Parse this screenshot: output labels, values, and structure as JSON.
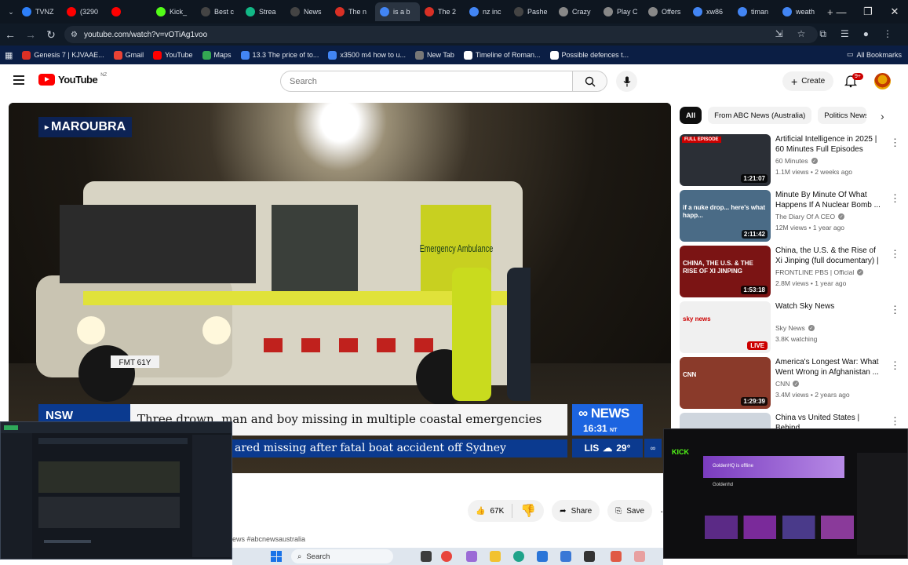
{
  "browser": {
    "tabs": [
      {
        "label": "TVNZ",
        "color": "#2d7ff9"
      },
      {
        "label": "(3290",
        "color": "#ff0000"
      },
      {
        "label": "",
        "color": "#ff0000"
      },
      {
        "label": "Kick_",
        "color": "#53fc18"
      },
      {
        "label": "Best c",
        "color": "#444444"
      },
      {
        "label": "Strea",
        "color": "#12b886"
      },
      {
        "label": "News",
        "color": "#444444"
      },
      {
        "label": "The n",
        "color": "#d93025"
      },
      {
        "label": "is a b",
        "color": "#4285f4"
      },
      {
        "label": "The 2",
        "color": "#d93025"
      },
      {
        "label": "nz inc",
        "color": "#4285f4"
      },
      {
        "label": "Pashe",
        "color": "#444444"
      },
      {
        "label": "Crazy",
        "color": "#888888"
      },
      {
        "label": "Play C",
        "color": "#888888"
      },
      {
        "label": "Offers",
        "color": "#888888"
      },
      {
        "label": "xw86",
        "color": "#4285f4"
      },
      {
        "label": "timan",
        "color": "#4285f4"
      },
      {
        "label": "weath",
        "color": "#4285f4"
      }
    ],
    "new_tab": "+",
    "url": "youtube.com/watch?v=vOTiAg1voo",
    "bookmarks": [
      {
        "label": "Genesis 7 | KJVAAE...",
        "color": "#d93025"
      },
      {
        "label": "Gmail",
        "color": "#ea4335"
      },
      {
        "label": "YouTube",
        "color": "#ff0000"
      },
      {
        "label": "Maps",
        "color": "#34a853"
      },
      {
        "label": "13.3 The price of to...",
        "color": "#4285f4"
      },
      {
        "label": "x3500 m4 how to u...",
        "color": "#4285f4"
      },
      {
        "label": "New Tab",
        "color": "#777777"
      },
      {
        "label": "Timeline of Roman...",
        "color": "#ffffff"
      },
      {
        "label": "Possible defences t...",
        "color": "#ffffff"
      }
    ],
    "all_bookmarks": "All Bookmarks"
  },
  "youtube": {
    "logo": "YouTube",
    "region": "NZ",
    "search_placeholder": "Search",
    "create": "Create",
    "notifications": "9+"
  },
  "video": {
    "location_tag": "MAROUBRA",
    "region_tag": "NSW",
    "headline": "Three drown, man and boy missing in multiple coastal emergencies",
    "ticker": "ared missing after fatal boat accident off Sydney",
    "channel_logo": "NEWS",
    "time": "16:31",
    "time_zone": "NT",
    "weather_city": "LIS",
    "temperature": "29°",
    "vehicle_text": "Emergency Ambulance",
    "plate": "FMT 61Y"
  },
  "actions": {
    "likes": "67K",
    "share": "Share",
    "save": "Save",
    "more": "···"
  },
  "description_snippet": "ews #abcnewsaustralia",
  "chips": [
    "All",
    "From ABC News (Australia)",
    "Politics News"
  ],
  "recommendations": [
    {
      "title": "Artificial Intelligence in 2025 | 60 Minutes Full Episodes",
      "channel": "60 Minutes",
      "meta": "1.1M views • 2 weeks ago",
      "duration": "1:21:07",
      "badge": "FULL EPISODE",
      "thumb": "#2b2f36"
    },
    {
      "title": "Minute By Minute Of What Happens If A Nuclear Bomb ...",
      "channel": "The Diary Of A CEO",
      "meta": "12M views • 1 year ago",
      "duration": "2:11:42",
      "overlay": "if a nuke drop... here's what happ...",
      "thumb": "#4a6b86"
    },
    {
      "title": "China, the U.S. & the Rise of Xi Jinping (full documentary) | ...",
      "channel": "FRONTLINE PBS | Official",
      "meta": "2.8M views • 1 year ago",
      "duration": "1:53:18",
      "overlay": "CHINA, THE U.S. & THE RISE OF XI JINPING",
      "thumb": "#7b1414"
    },
    {
      "title": "Watch Sky News",
      "channel": "Sky News",
      "meta": "3.8K watching",
      "live": "LIVE",
      "overlay": "sky news",
      "thumb": "#f0f0f0"
    },
    {
      "title": "America's Longest War: What Went Wrong in Afghanistan ...",
      "channel": "CNN",
      "meta": "3.4M views • 2 years ago",
      "duration": "1:29:39",
      "overlay": "CNN",
      "thumb": "#8a3a2a"
    },
    {
      "title": "China vs United States | Behind",
      "channel": "",
      "meta": "",
      "thumb": "#cfd6de"
    }
  ],
  "taskbar": {
    "search": "Search"
  },
  "overlays": {
    "kick_channel": "GoldenHQ is offline",
    "kick_name": "Goldenhd",
    "kick_brand": "KICK"
  }
}
